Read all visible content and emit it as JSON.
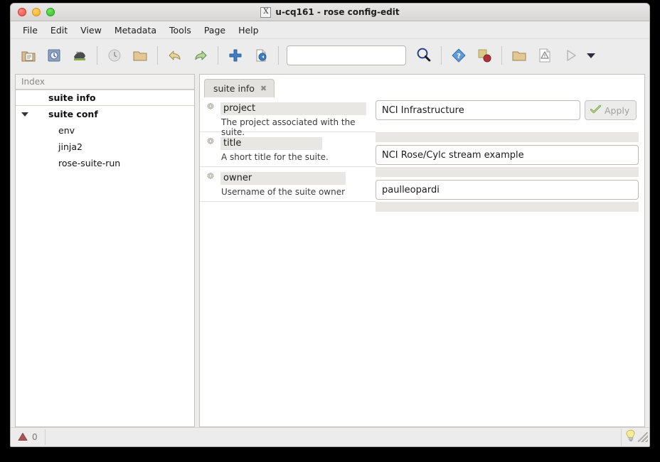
{
  "window": {
    "title": "u-cq161 - rose config-edit",
    "app_icon": "x11-logo-icon",
    "buttons": {
      "close": "close-button",
      "minimize": "minimize-button",
      "maximize": "maximize-button"
    }
  },
  "menubar": {
    "items": [
      {
        "label": "File"
      },
      {
        "label": "Edit"
      },
      {
        "label": "View"
      },
      {
        "label": "Metadata"
      },
      {
        "label": "Tools"
      },
      {
        "label": "Page"
      },
      {
        "label": "Help"
      }
    ]
  },
  "toolbar": {
    "buttons": [
      {
        "name": "open-suite-icon",
        "title": "Open Suite"
      },
      {
        "name": "save-icon",
        "title": "Save"
      },
      {
        "name": "browse-icon",
        "title": "Browse"
      },
      {
        "name": "check-all-icon",
        "title": "Check All"
      },
      {
        "name": "load-directory-icon",
        "title": "Load Directory"
      },
      {
        "name": "undo-icon",
        "title": "Undo"
      },
      {
        "name": "redo-icon",
        "title": "Redo"
      },
      {
        "name": "add-icon",
        "title": "Add"
      },
      {
        "name": "revert-icon",
        "title": "Revert"
      },
      {
        "name": "find-icon",
        "title": "Find"
      },
      {
        "name": "help-icon",
        "title": "Help"
      },
      {
        "name": "view-latent-icon",
        "title": "View Latent Variables"
      },
      {
        "name": "open-output-icon",
        "title": "Open Output"
      },
      {
        "name": "view-errors-icon",
        "title": "View Errors"
      },
      {
        "name": "run-suite-icon",
        "title": "Run Suite"
      },
      {
        "name": "run-options-caret-icon",
        "title": "Run Options"
      }
    ],
    "search": {
      "value": "",
      "placeholder": ""
    },
    "search_button_label": "search-icon"
  },
  "index_pane": {
    "header": "Index",
    "items": [
      {
        "label": "suite info",
        "bold": true,
        "indent": 0,
        "selected": true,
        "expander": "none"
      },
      {
        "label": "suite conf",
        "bold": true,
        "indent": 0,
        "selected": false,
        "expander": "down"
      },
      {
        "label": "env",
        "bold": false,
        "indent": 1,
        "selected": false,
        "expander": "none"
      },
      {
        "label": "jinja2",
        "bold": false,
        "indent": 1,
        "selected": false,
        "expander": "none"
      },
      {
        "label": "rose-suite-run",
        "bold": false,
        "indent": 1,
        "selected": false,
        "expander": "none"
      }
    ]
  },
  "main": {
    "tabs": [
      {
        "label": "suite info",
        "close": "✖",
        "active": true
      }
    ],
    "fields": [
      {
        "key": "project",
        "help": "The project associated with the suite.",
        "value": "NCI Infrastructure",
        "key_width": 205,
        "value_width": 288,
        "has_apply": true,
        "apply_label": "Apply",
        "apply_enabled": false
      },
      {
        "key": "title",
        "help": "A short title for the suite.",
        "value": "NCI Rose/Cylc stream example",
        "key_width": 143,
        "value_width": 362,
        "has_apply": false,
        "apply_label": "Apply",
        "apply_enabled": false
      },
      {
        "key": "owner",
        "help": "Username of the suite owner",
        "value": "paulleopardi",
        "key_width": 176,
        "value_width": 362,
        "has_apply": false,
        "apply_label": "Apply",
        "apply_enabled": false
      }
    ]
  },
  "statusbar": {
    "error_icon": "error-triangle-icon",
    "error_count": "0",
    "hint_icon": "lightbulb-icon",
    "resize_grip": "resize-grip-icon"
  },
  "colors": {
    "window_bg": "#ececec",
    "pane_bg": "#ffffff",
    "accent_blue": "#2a5db0",
    "label_highlight": "#e9e7e4",
    "border": "#c3bfba"
  }
}
